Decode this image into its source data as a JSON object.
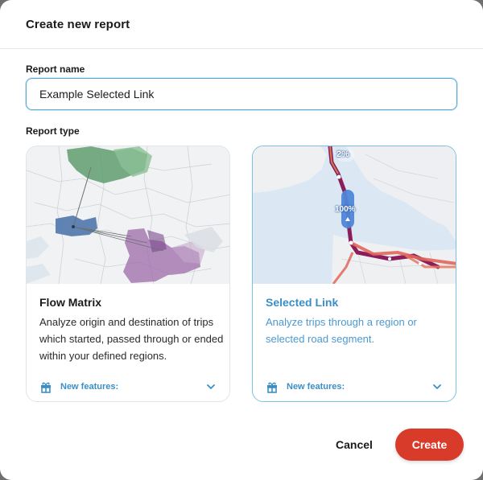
{
  "dialog": {
    "title": "Create new report"
  },
  "report_name": {
    "label": "Report name",
    "value": "Example Selected Link"
  },
  "report_type": {
    "label": "Report type",
    "options": [
      {
        "title": "Flow Matrix",
        "description": "Analyze origin and destination of trips which started, passed through or ended within your defined regions.",
        "features_label": "New features:",
        "selected": false
      },
      {
        "title": "Selected Link",
        "description": "Analyze trips through a region or selected road segment.",
        "features_label": "New features:",
        "selected": true,
        "map_labels": [
          "2%",
          "100%"
        ]
      }
    ]
  },
  "actions": {
    "cancel_label": "Cancel",
    "create_label": "Create"
  },
  "colors": {
    "accent": "#3a8fc6",
    "primary_button": "#d93b2b",
    "selected_border": "#7cc0e4"
  },
  "icons": {
    "features": "gift-icon",
    "expand": "chevron-down-icon"
  }
}
